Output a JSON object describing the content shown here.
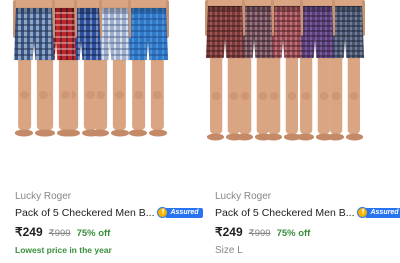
{
  "products": [
    {
      "brand": "Lucky Roger",
      "title": "Pack of 5 Checkered Men B...",
      "assured_label": "Assured",
      "price": "₹249",
      "mrp": "₹999",
      "discount": "75% off",
      "note": "Lowest price in the year",
      "size": ""
    },
    {
      "brand": "Lucky Roger",
      "title": "Pack of 5 Checkered Men B...",
      "assured_label": "Assured",
      "price": "₹249",
      "mrp": "₹999",
      "discount": "75% off",
      "note": "",
      "size": "Size L"
    }
  ],
  "colors": {
    "left_boxers": [
      "#3b5a8c",
      "#c0262d",
      "#2e4f9c",
      "#6f88b8",
      "#2f78c8"
    ],
    "right_boxers": [
      "#7a3a3a",
      "#6e4d5a",
      "#9b4a52",
      "#5a3f7a",
      "#4a5670"
    ],
    "skin": "#d9a582",
    "accent": "#2874f0",
    "discount": "#388e3c"
  }
}
